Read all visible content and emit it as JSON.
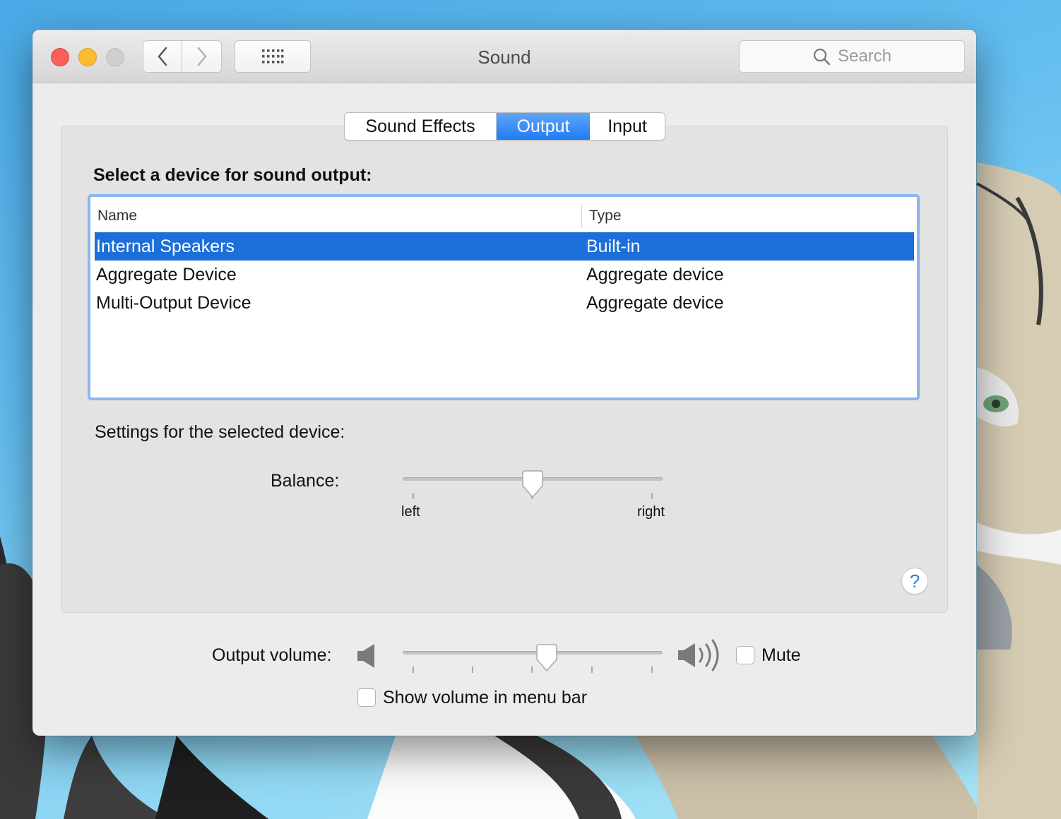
{
  "window": {
    "title": "Sound",
    "search_placeholder": "Search"
  },
  "toolbar": {
    "back_icon": "chevron-left-icon",
    "forward_icon": "chevron-right-icon",
    "show_all_icon": "grid-icon"
  },
  "tabs": [
    {
      "label": "Sound Effects",
      "selected": false
    },
    {
      "label": "Output",
      "selected": true
    },
    {
      "label": "Input",
      "selected": false
    }
  ],
  "output": {
    "heading": "Select a device for sound output:",
    "columns": {
      "name": "Name",
      "type": "Type"
    },
    "devices": [
      {
        "name": "Internal Speakers",
        "type": "Built-in",
        "selected": true
      },
      {
        "name": "Aggregate Device",
        "type": "Aggregate device",
        "selected": false
      },
      {
        "name": "Multi-Output Device",
        "type": "Aggregate device",
        "selected": false
      }
    ],
    "settings_label": "Settings for the selected device:",
    "balance": {
      "label": "Balance:",
      "left_label": "left",
      "right_label": "right",
      "value": 0.5
    }
  },
  "help": {
    "label": "?"
  },
  "volume": {
    "label": "Output volume:",
    "value": 0.56,
    "mute_label": "Mute",
    "mute_checked": false,
    "show_in_menu_bar_label": "Show volume in menu bar",
    "show_in_menu_bar_checked": false
  },
  "colors": {
    "accent": "#1c6fd8",
    "tab_selected": "#2a82f4",
    "focus_ring": "#8cb7ee"
  }
}
